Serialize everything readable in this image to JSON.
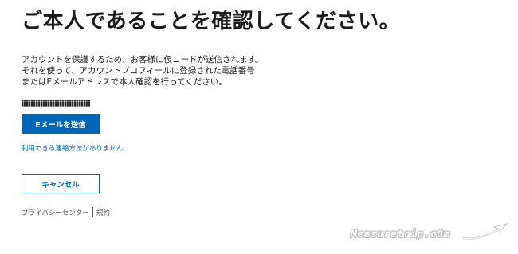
{
  "heading": "ご本人であることを確認してください。",
  "description": {
    "line1": "アカウントを保護するため、お客様に仮コードが送信されます。",
    "line2": "それを使って、アカウントプロフィールに登録された電話番号",
    "line3": "またはEメールアドレスで本人確認を行ってください。"
  },
  "actions": {
    "send_email_label": "Eメールを送信",
    "no_methods_link": "利用できる連絡方法がありません",
    "cancel_label": "キャンセル"
  },
  "footer": {
    "privacy_link": "プライバシーセンター",
    "terms_link": "規約"
  },
  "watermark": {
    "text": "Measuretrip.c0m"
  },
  "colors": {
    "accent": "#0067b8",
    "text": "#1b1b1b",
    "footer_text": "#555555"
  }
}
